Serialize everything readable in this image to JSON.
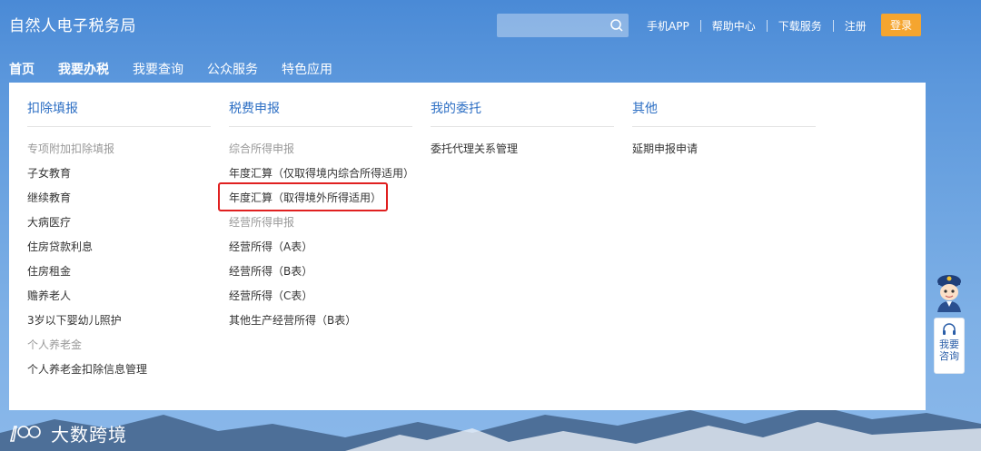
{
  "header": {
    "brand": "自然人电子税务局",
    "search": {
      "placeholder": ""
    },
    "links": [
      "手机APP",
      "帮助中心",
      "下载服务",
      "注册"
    ],
    "login_label": "登录"
  },
  "nav": {
    "items": [
      "首页",
      "我要办税",
      "我要查询",
      "公众服务",
      "特色应用"
    ]
  },
  "menu": {
    "columns": [
      {
        "title": "扣除填报",
        "entries": [
          {
            "label": "专项附加扣除填报",
            "kind": "sub"
          },
          {
            "label": "子女教育",
            "kind": "link"
          },
          {
            "label": "继续教育",
            "kind": "link"
          },
          {
            "label": "大病医疗",
            "kind": "link"
          },
          {
            "label": "住房贷款利息",
            "kind": "link"
          },
          {
            "label": "住房租金",
            "kind": "link"
          },
          {
            "label": "赡养老人",
            "kind": "link"
          },
          {
            "label": "3岁以下婴幼儿照护",
            "kind": "link"
          },
          {
            "label": "个人养老金",
            "kind": "sub"
          },
          {
            "label": "个人养老金扣除信息管理",
            "kind": "link"
          }
        ]
      },
      {
        "title": "税费申报",
        "entries": [
          {
            "label": "综合所得申报",
            "kind": "sub"
          },
          {
            "label": "年度汇算（仅取得境内综合所得适用）",
            "kind": "link"
          },
          {
            "label": "年度汇算（取得境外所得适用）",
            "kind": "link"
          },
          {
            "label": "经营所得申报",
            "kind": "sub"
          },
          {
            "label": "经营所得（A表）",
            "kind": "link"
          },
          {
            "label": "经营所得（B表）",
            "kind": "link"
          },
          {
            "label": "经营所得（C表）",
            "kind": "link"
          },
          {
            "label": "其他生产经营所得（B表）",
            "kind": "link"
          }
        ]
      },
      {
        "title": "我的委托",
        "entries": [
          {
            "label": "委托代理关系管理",
            "kind": "link"
          }
        ]
      },
      {
        "title": "其他",
        "entries": [
          {
            "label": "延期申报申请",
            "kind": "link"
          }
        ]
      }
    ]
  },
  "assistant": {
    "label": "我要咨询"
  },
  "watermark": {
    "text": "大数跨境"
  },
  "colors": {
    "accent": "#2d6fc4",
    "login": "#f5a52f",
    "highlight": "#e02020"
  }
}
